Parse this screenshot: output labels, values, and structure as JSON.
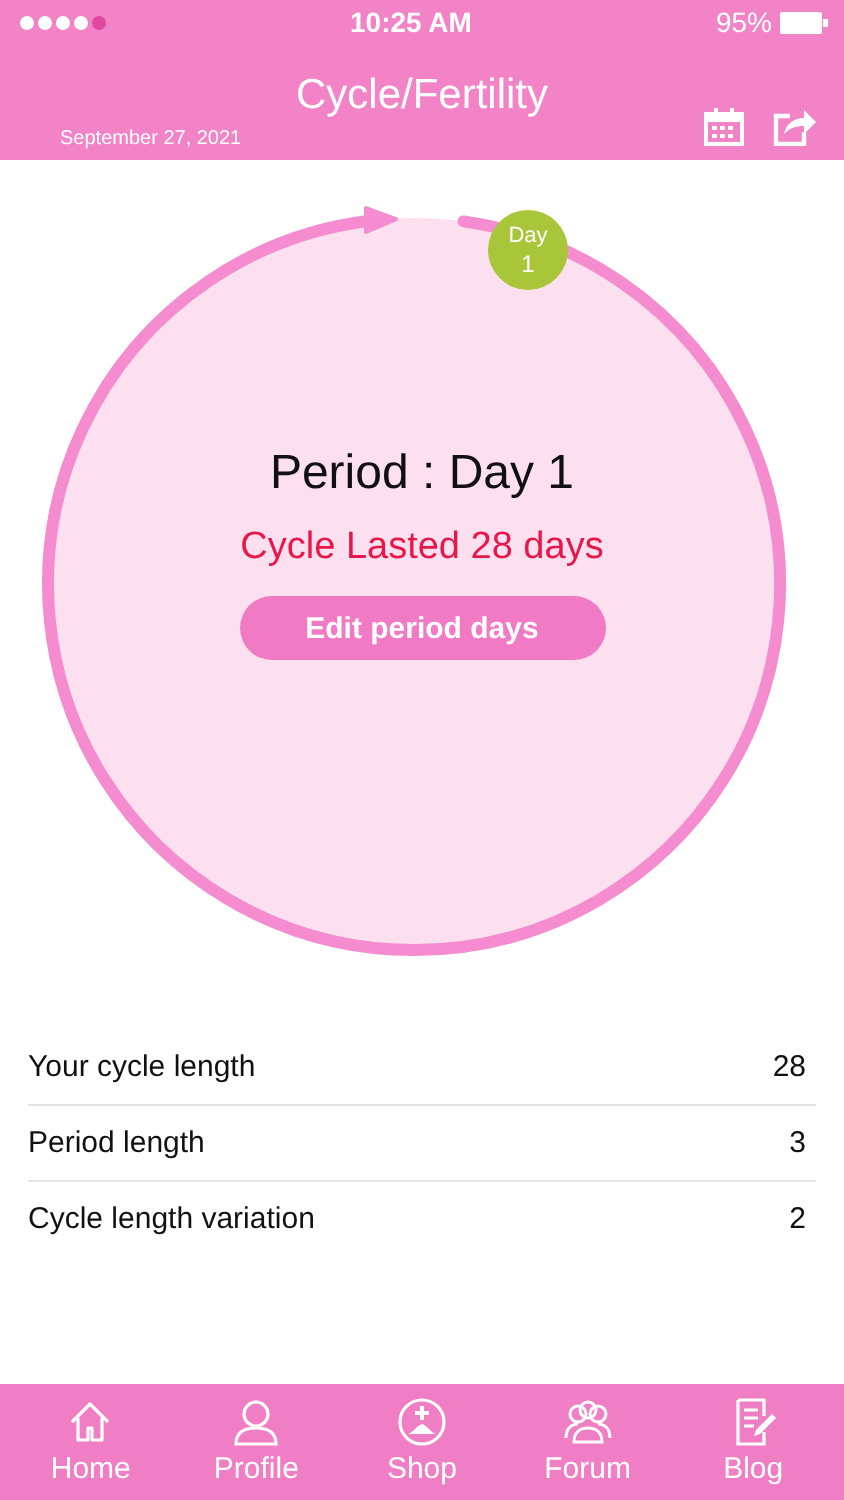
{
  "status_bar": {
    "time": "10:25 AM",
    "battery": "95%"
  },
  "header": {
    "title": "Cycle/Fertility",
    "date": "September 27, 2021"
  },
  "cycle": {
    "badge_label": "Day",
    "badge_day": "1",
    "title": "Period : Day 1",
    "subtitle": "Cycle Lasted 28 days",
    "button": "Edit period days"
  },
  "stats": [
    {
      "label": "Your cycle length",
      "value": "28"
    },
    {
      "label": "Period length",
      "value": "3"
    },
    {
      "label": "Cycle length variation",
      "value": "2"
    }
  ],
  "tabs": [
    {
      "label": "Home",
      "kind": "home"
    },
    {
      "label": "Profile",
      "kind": "profile"
    },
    {
      "label": "Shop",
      "kind": "shop"
    },
    {
      "label": "Forum",
      "kind": "forum"
    },
    {
      "label": "Blog",
      "kind": "blog"
    }
  ]
}
